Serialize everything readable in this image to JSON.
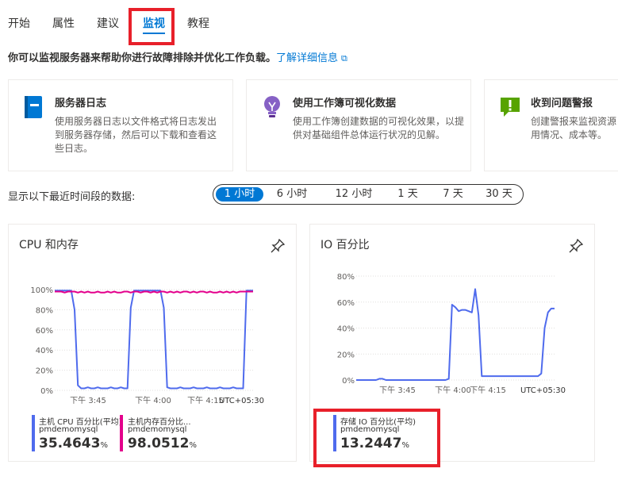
{
  "tabs": [
    "开始",
    "属性",
    "建议",
    "监视",
    "教程"
  ],
  "active_tab": "监视",
  "description": {
    "text": "你可以监视服务器来帮助你进行故障排除并优化工作负载。",
    "link": "了解详细信息"
  },
  "cards": [
    {
      "title": "服务器日志",
      "body": "使用服务器日志以文件格式将日志发出到服务器存储，然后可以下载和查看这些日志。",
      "icon": "book-icon"
    },
    {
      "title": "使用工作簿可视化数据",
      "body": "使用工作簿创建数据的可视化效果，以提供对基础组件总体运行状况的见解。",
      "icon": "lightbulb-icon"
    },
    {
      "title": "收到问题警报",
      "body": "创建警报来监视资源用情况、成本等。",
      "icon": "alert-icon"
    }
  ],
  "time_range": {
    "label": "显示以下最近时间段的数据:",
    "options": [
      "1 小时",
      "6 小时",
      "12 小时",
      "1 天",
      "7 天",
      "30 天"
    ],
    "selected": "1 小时"
  },
  "charts": {
    "cpu_memory": {
      "title": "CPU 和内存",
      "legend": [
        {
          "name": "主机 CPU 百分比(平均)",
          "resource": "pmdemomysql",
          "value": "35.4643",
          "unit": "%",
          "color": "#4f6bed"
        },
        {
          "name": "主机内存百分比...",
          "resource": "pmdemomysql",
          "value": "98.0512",
          "unit": "%",
          "color": "#e3008c"
        }
      ]
    },
    "io": {
      "title": "IO 百分比",
      "legend": [
        {
          "name": "存储 IO 百分比(平均)",
          "resource": "pmdemomysql",
          "value": "13.2447",
          "unit": "%",
          "color": "#4f6bed"
        }
      ]
    }
  },
  "chart_data": [
    {
      "type": "line",
      "title": "CPU 和内存",
      "x_ticks": [
        "下午 3:45",
        "下午 4:00",
        "下午 4:15"
      ],
      "timezone": "UTC+05:30",
      "y_ticks": [
        "0%",
        "20%",
        "40%",
        "60%",
        "80%",
        "100%"
      ],
      "ylim": [
        0,
        100
      ],
      "x": [
        0,
        1,
        2,
        3,
        4,
        5,
        6,
        7,
        8,
        9,
        10,
        11,
        12,
        13,
        14,
        15,
        16,
        17,
        18,
        19,
        20,
        21,
        22,
        23,
        24,
        25,
        26,
        27,
        28,
        29,
        30,
        31,
        32,
        33,
        34,
        35,
        36,
        37,
        38,
        39,
        40,
        41,
        42,
        43,
        44,
        45,
        46,
        47,
        48,
        49,
        50,
        51,
        52,
        53,
        54,
        55,
        56,
        57,
        58,
        59,
        60
      ],
      "series": [
        {
          "name": "主机 CPU 百分比(平均)",
          "color": "#4f6bed",
          "values": [
            99,
            99,
            99,
            99,
            99,
            99,
            80,
            5,
            2,
            2,
            3,
            2,
            2,
            3,
            2,
            2,
            2,
            3,
            2,
            2,
            3,
            2,
            2,
            82,
            99,
            99,
            99,
            99,
            99,
            99,
            99,
            99,
            99,
            82,
            3,
            2,
            2,
            2,
            3,
            2,
            2,
            2,
            3,
            2,
            2,
            2,
            3,
            2,
            2,
            2,
            3,
            2,
            2,
            2,
            3,
            2,
            2,
            2,
            99,
            99,
            99
          ]
        },
        {
          "name": "主机内存百分比...",
          "color": "#e3008c",
          "values": [
            98,
            98,
            98,
            97,
            98,
            98,
            98,
            97,
            98,
            97,
            98,
            97,
            97,
            98,
            97,
            97,
            98,
            97,
            98,
            97,
            97,
            98,
            98,
            97,
            98,
            98,
            97,
            98,
            98,
            97,
            98,
            97,
            98,
            98,
            97,
            98,
            97,
            98,
            97,
            98,
            98,
            97,
            98,
            97,
            98,
            98,
            97,
            98,
            97,
            97,
            98,
            97,
            98,
            97,
            98,
            97,
            98,
            98,
            98,
            98,
            98
          ]
        }
      ]
    },
    {
      "type": "line",
      "title": "IO 百分比",
      "x_ticks": [
        "下午 3:45",
        "下午 4:00",
        "下午 4:15"
      ],
      "timezone": "UTC+05:30",
      "y_ticks": [
        "0%",
        "20%",
        "40%",
        "60%",
        "80%"
      ],
      "ylim": [
        0,
        80
      ],
      "x": [
        0,
        1,
        2,
        3,
        4,
        5,
        6,
        7,
        8,
        9,
        10,
        11,
        12,
        13,
        14,
        15,
        16,
        17,
        18,
        19,
        20,
        21,
        22,
        23,
        24,
        25,
        26,
        27,
        28,
        29,
        30,
        31,
        32,
        33,
        34,
        35,
        36,
        37,
        38,
        39,
        40,
        41,
        42,
        43,
        44,
        45,
        46,
        47,
        48,
        49,
        50,
        51,
        52,
        53,
        54,
        55,
        56,
        57,
        58,
        59,
        60
      ],
      "series": [
        {
          "name": "存储 IO 百分比(平均)",
          "color": "#4f6bed",
          "values": [
            0,
            0,
            0,
            0,
            0,
            0,
            0,
            1,
            1,
            0,
            0,
            0,
            0,
            0,
            0,
            0,
            0,
            0,
            0,
            0,
            0,
            0,
            0,
            0,
            0,
            0,
            0,
            0,
            1,
            58,
            56,
            53,
            54,
            54,
            53,
            52,
            70,
            50,
            3,
            3,
            3,
            3,
            3,
            3,
            3,
            3,
            3,
            3,
            3,
            3,
            3,
            3,
            3,
            3,
            3,
            3,
            5,
            40,
            52,
            55,
            55
          ]
        }
      ]
    }
  ]
}
